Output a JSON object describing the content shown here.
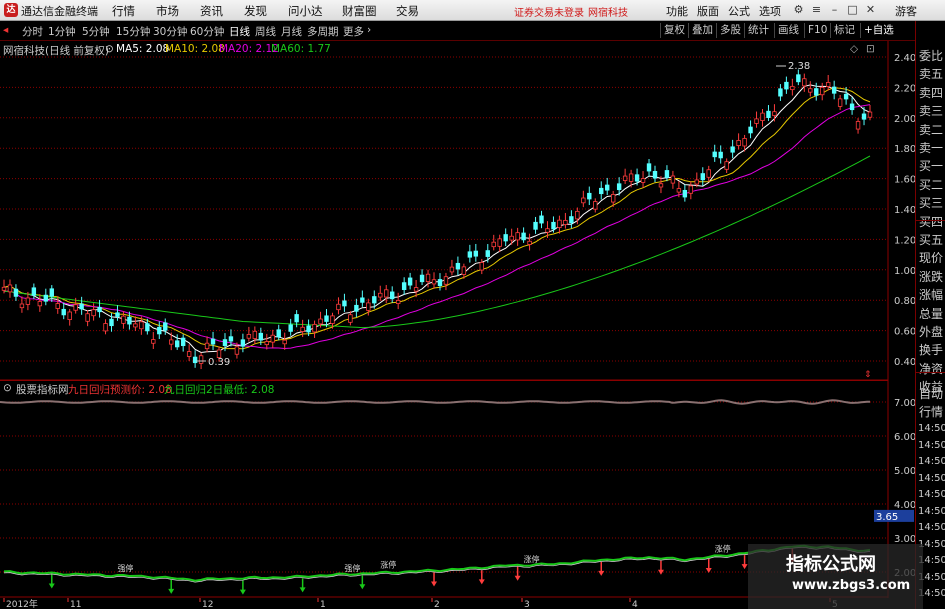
{
  "app": {
    "name": "通达信金融终端",
    "menu": [
      "行情",
      "市场",
      "资讯",
      "发现",
      "问小达",
      "财富圈",
      "交易"
    ],
    "notice": "证券交易未登录",
    "notice_stock": "网宿科技",
    "right_menu": [
      "功能",
      "版面",
      "公式",
      "选项"
    ],
    "guest": "游客"
  },
  "toolbar": {
    "periods": [
      "分时",
      "1分钟",
      "5分钟",
      "15分钟",
      "30分钟",
      "60分钟",
      "日线",
      "周线",
      "月线",
      "多周期",
      "更多"
    ],
    "active_period": "日线",
    "buttons": [
      "复权",
      "叠加",
      "多股",
      "统计",
      "画线",
      "F10",
      "标记",
      "+自选"
    ]
  },
  "main_panel": {
    "title": "网宿科技(日线 前复权)",
    "ma5": "MA5: 2.08",
    "ma10": "MA10: 2.08",
    "ma20": "MA20: 2.12",
    "ma60": "MA60: 1.77",
    "y_labels": [
      "2.40",
      "2.20",
      "2.00",
      "1.80",
      "1.60",
      "1.40",
      "1.20",
      "1.00",
      "0.80",
      "0.60",
      "0.40"
    ],
    "high_label": "2.38",
    "low_label": "0.39",
    "colors": {
      "ma5": "#ffffff",
      "ma10": "#e6c800",
      "ma20": "#e000e0",
      "ma60": "#19c819",
      "up": "#ff3c3c",
      "down": "#54ffff",
      "grid": "#8b0000"
    }
  },
  "sub_panel": {
    "title": "股票指标网",
    "label1": "九日回归预测价: 2.08",
    "label2": "九日回归2日最低: 2.08",
    "y_labels": [
      "7.00",
      "6.00",
      "5.00",
      "4.00",
      "3.00",
      "2.00"
    ],
    "current_value": "3.65",
    "marker_text": "强停",
    "marker_text2": "涨停"
  },
  "x_axis": {
    "labels": [
      "2012年",
      "11",
      "12",
      "1",
      "2",
      "3",
      "4",
      "5"
    ]
  },
  "right_panel": {
    "items": [
      "委比",
      "卖五",
      "卖四",
      "卖三",
      "卖二",
      "卖一",
      "买一",
      "买二",
      "买三",
      "买四",
      "买五",
      "现价",
      "涨跌",
      "涨幅",
      "总量",
      "外盘",
      "换手",
      "净资",
      "收益"
    ],
    "lower_items": [
      "自动",
      "行情"
    ],
    "times": [
      "14:50",
      "14:50",
      "14:50",
      "14:50",
      "14:50",
      "14:50",
      "14:50",
      "14:50",
      "14:50",
      "14:50",
      "14:50"
    ]
  },
  "watermark": {
    "title": "指标公式网",
    "url": "www.zbgs3.com"
  }
}
